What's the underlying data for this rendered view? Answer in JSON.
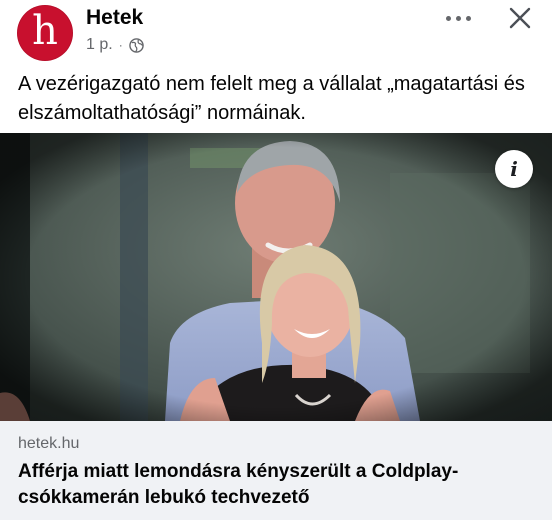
{
  "post": {
    "page_name": "Hetek",
    "avatar_letter": "h",
    "time": "1 p.",
    "separator": "·",
    "privacy_icon": "globe-icon",
    "more_icon": "more-horizontal-icon",
    "close_icon": "close-icon",
    "caption": "A vezérigazgató nem felelt meg a vállalat „magatartási és elszámoltathatósági” normáinak."
  },
  "link_preview": {
    "info_label": "i",
    "domain": "hetek.hu",
    "headline": "Afférja miatt lemondásra kényszerült a Coldplay-csókkamerán lebukó techvezető"
  },
  "colors": {
    "brand": "#c8102e",
    "secondary_text": "#65676b",
    "preview_bg": "#f0f2f5"
  }
}
